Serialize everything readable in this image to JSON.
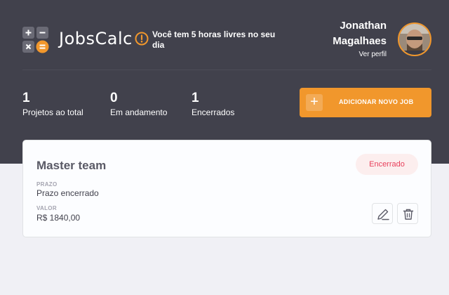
{
  "app": {
    "logo_text": "JobsCalc"
  },
  "alert": {
    "text": "Você tem 5 horas livres no seu dia",
    "icon": "alert-icon"
  },
  "profile": {
    "name": "Jonathan Magalhaes",
    "link_label": "Ver perfil"
  },
  "stats": [
    {
      "value": "1",
      "label": "Projetos ao total"
    },
    {
      "value": "0",
      "label": "Em andamento"
    },
    {
      "value": "1",
      "label": "Encerrados"
    }
  ],
  "add_job": {
    "label": "ADICIONAR NOVO JOB",
    "icon": "plus-icon"
  },
  "job": {
    "title": "Master team",
    "status": "Encerrado",
    "deadline_label": "PRAZO",
    "deadline_value": "Prazo encerrado",
    "value_label": "VALOR",
    "value_value": "R$ 1840,00",
    "actions": [
      "edit-icon",
      "trash-icon"
    ]
  },
  "colors": {
    "header_bg": "#41414c",
    "accent": "#f1972c",
    "status_closed_bg": "#fceeee",
    "status_closed_text": "#e83f5b",
    "page_bg": "#f0f0f5"
  }
}
